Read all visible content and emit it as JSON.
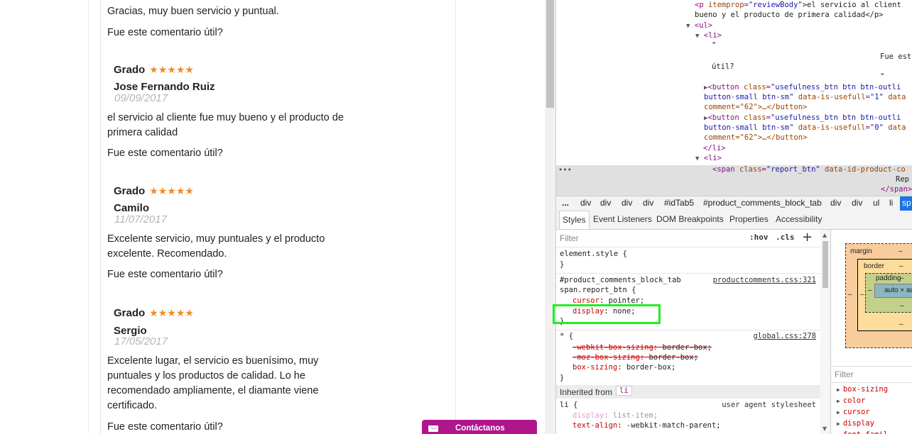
{
  "reviews_partial_top": {
    "body": "Gracias, muy buen servicio y puntual.",
    "useful": "Fue este comentario útil?"
  },
  "reviews": [
    {
      "grade_label": "Grado",
      "stars": "★★★★★",
      "author": "Jose Fernando Ruiz",
      "date": "09/09/2017",
      "body_lines": [
        "el servicio al cliente fue muy bueno y el producto de",
        "primera calidad"
      ],
      "useful": "Fue este comentario útil?"
    },
    {
      "grade_label": "Grado",
      "stars": "★★★★★",
      "author": "Camilo",
      "date": "11/07/2017",
      "body_lines": [
        "Excelente servicio, muy puntuales y el producto",
        "excelente. Recomendado."
      ],
      "useful": "Fue este comentario útil?"
    },
    {
      "grade_label": "Grado",
      "stars": "★★★★★",
      "author": "Sergio",
      "date": "17/05/2017",
      "body_lines": [
        "Excelente lugar, el servicio es buenísimo, muy",
        "puntuales y los productos de calidad. Lo he",
        "recomendado ampliamente, el diamante viene",
        "certificado."
      ],
      "useful": "Fue este comentario útil?"
    }
  ],
  "contact_button": {
    "label": "Contáctanos",
    "icon": "mail-icon"
  },
  "devtools": {
    "dom_lines": [
      {
        "pre": "<p ",
        "attr": "itemprop",
        "val": "\"reviewBody\"",
        "post": ">el servicio al client",
        "tri": ""
      },
      {
        "text": "bueno y el producto de primera calidad</p>"
      },
      {
        "tri": "▼",
        "tag": "<ul>"
      },
      {
        "tri": "▼",
        "tag": "<li>"
      },
      {
        "text": "\""
      },
      {
        "text": "Fue est"
      },
      {
        "text": "útil?"
      },
      {
        "text": "\""
      },
      {
        "tri": "▶",
        "pre": "<button ",
        "attr": "class",
        "val": "\"usefulness_btn btn btn-outli",
        "post": ""
      },
      {
        "cont": "button-small btn-sm\" ",
        "attr": "data-is-usefull",
        "val": "\"1\"",
        "post": " data"
      },
      {
        "cont": "comment=\"62\">…</button>"
      },
      {
        "tri": "▶",
        "pre": "<button ",
        "attr": "class",
        "val": "\"usefulness_btn btn btn-outli",
        "post": ""
      },
      {
        "cont": "button-small btn-sm\" ",
        "attr": "data-is-usefull",
        "val": "\"0\"",
        "post": " data"
      },
      {
        "cont": "comment=\"62\">…</button>"
      },
      {
        "tag": "</li>"
      },
      {
        "tri": "▼",
        "tag": "<li>"
      },
      {
        "pre": "<span ",
        "attr": "class",
        "val": "\"report_btn\"",
        "post": " data-id-product-co"
      },
      {
        "text": "Rep"
      },
      {
        "tag": "</span>"
      }
    ],
    "dom_ellipsis": "•••",
    "breadcrumbs": [
      "...",
      "div",
      "div",
      "div",
      "div",
      "#idTab5",
      "#product_comments_block_tab",
      "div",
      "div",
      "ul",
      "li",
      "sp"
    ],
    "tabs": [
      "Styles",
      "Event Listeners",
      "DOM Breakpoints",
      "Properties",
      "Accessibility"
    ],
    "filter_placeholder": "Filter",
    "hov_label": ":hov",
    "cls_label": ".cls",
    "add_rule_label": "+",
    "rules": {
      "element_style_selector": "element.style {",
      "element_style_close": "}",
      "rule1_selector_1": "#product_comments_block_tab",
      "rule1_selector_2": "span.report_btn {",
      "rule1_link": "productcomments.css:321",
      "rule1_prop1_name": "cursor",
      "rule1_prop1_value": "pointer;",
      "rule1_prop2_name": "display",
      "rule1_prop2_value": "none;",
      "rule1_close": "}",
      "rule2_selector": "* {",
      "rule2_link": "global.css:278",
      "rule2_prop1_name": "-webkit-box-sizing",
      "rule2_prop1_value": "border-box;",
      "rule2_prop2_name": "-moz-box-sizing",
      "rule2_prop2_value": "border-box;",
      "rule2_prop3_name": "box-sizing",
      "rule2_prop3_value": "border-box;",
      "rule2_close": "}",
      "inherited_label": "Inherited from",
      "inherited_tag": "li",
      "rule3_selector": "li {",
      "rule3_note": "user agent stylesheet",
      "rule3_prop1_name": "display",
      "rule3_prop1_value": "list-item;",
      "rule3_prop2_name": "text-align",
      "rule3_prop2_value": "-webkit-match-parent;"
    },
    "box_model": {
      "margin_label": "margin",
      "border_label": "border",
      "padding_label": "padding",
      "dash": "–",
      "content": "auto × au"
    },
    "computed_filter_placeholder": "Filter",
    "computed_props": [
      "box-sizing",
      "color",
      "cursor",
      "display",
      "font-famil"
    ]
  },
  "colors": {
    "star": "#f08a2a",
    "contact_bg": "#b0158c",
    "highlight": "#22ee22",
    "selected_crumb": "#1a73e8"
  }
}
